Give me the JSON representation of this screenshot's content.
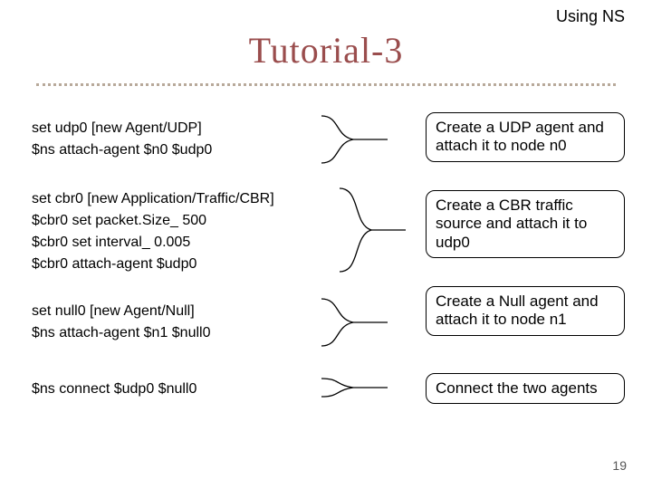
{
  "header": {
    "label": "Using NS"
  },
  "title": "Tutorial-3",
  "code": {
    "block1": {
      "line1": "set udp0 [new Agent/UDP]",
      "line2": "$ns attach-agent $n0 $udp0"
    },
    "block2": {
      "line1": "set cbr0 [new Application/Traffic/CBR]",
      "line2": "$cbr0 set packet.Size_ 500",
      "line3": "$cbr0 set interval_ 0.005",
      "line4": "$cbr0 attach-agent $udp0"
    },
    "block3": {
      "line1": "set null0 [new Agent/Null]",
      "line2": "$ns attach-agent $n1 $null0"
    },
    "block4": {
      "line1": "$ns connect $udp0 $null0"
    }
  },
  "callouts": {
    "c1": "Create a UDP agent and attach it to node n0",
    "c2": "Create a CBR traffic source and attach it to udp0",
    "c3": "Create a Null agent and attach it to node n1",
    "c4": "Connect the two agents"
  },
  "page_number": "19"
}
